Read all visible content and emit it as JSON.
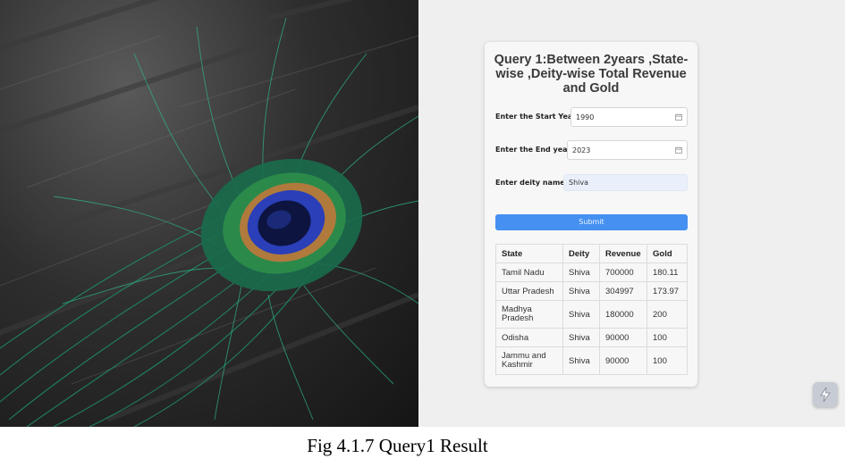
{
  "form": {
    "title": "Query 1:Between 2years ,State-wise ,Deity-wise Total Revenue and Gold",
    "start_year_label": "Enter the Start Year:",
    "start_year_value": "1990",
    "end_year_label": "Enter the End year:",
    "end_year_value": "2023",
    "deity_label": "Enter deity name:",
    "deity_value": "Shiva",
    "submit_label": "Submit"
  },
  "table": {
    "headers": [
      "State",
      "Deity",
      "Revenue",
      "Gold"
    ],
    "rows": [
      [
        "Tamil Nadu",
        "Shiva",
        "700000",
        "180.11"
      ],
      [
        "Uttar Pradesh",
        "Shiva",
        "304997",
        "173.97"
      ],
      [
        "Madhya Pradesh",
        "Shiva",
        "180000",
        "200"
      ],
      [
        "Odisha",
        "Shiva",
        "90000",
        "100"
      ],
      [
        "Jammu and Kashmir",
        "Shiva",
        "90000",
        "100"
      ]
    ]
  },
  "caption": "Fig 4.1.7 Query1 Result",
  "icons": {
    "calendar": "calendar-icon",
    "assistant": "streamlit-bolt-icon"
  },
  "colors": {
    "submit": "#4590f1",
    "filled_input": "#e9f0fc",
    "feather_eye": "#2a3fb8"
  }
}
